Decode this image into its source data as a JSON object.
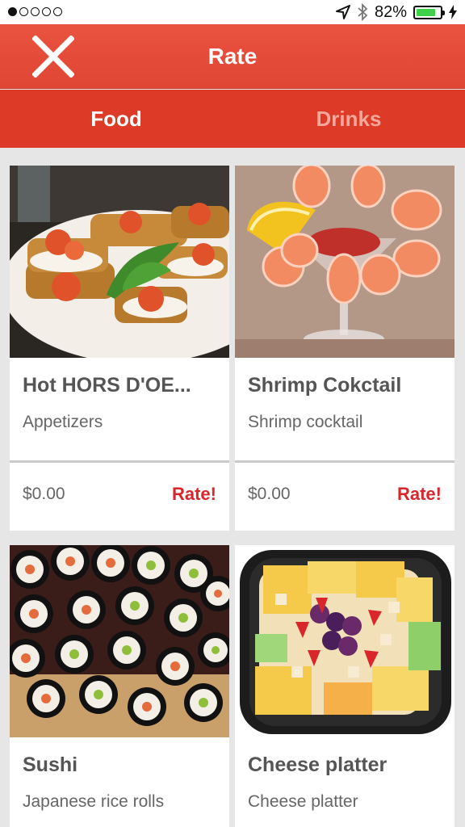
{
  "status_bar": {
    "signal_dots": 5,
    "signal_filled": 1,
    "battery_text": "82%",
    "battery_level": 0.82,
    "icons": [
      "location-arrow-icon",
      "bluetooth-icon",
      "battery-icon",
      "charging-bolt-icon"
    ]
  },
  "navbar": {
    "title": "Rate",
    "close_icon": "close-icon"
  },
  "tabs": [
    {
      "label": "Food",
      "active": true
    },
    {
      "label": "Drinks",
      "active": false
    }
  ],
  "items": [
    {
      "title": "Hot HORS D'OE...",
      "subtitle": "Appetizers",
      "price": "$0.00",
      "action": "Rate!",
      "image": "bruschetta-photo"
    },
    {
      "title": "Shrimp Cokctail",
      "subtitle": "Shrimp cocktail",
      "price": "$0.00",
      "action": "Rate!",
      "image": "shrimp-cocktail-photo"
    },
    {
      "title": "Sushi",
      "subtitle": "Japanese rice rolls",
      "image": "sushi-photo"
    },
    {
      "title": "Cheese platter",
      "subtitle": "Cheese platter",
      "image": "cheese-platter-photo"
    }
  ],
  "colors": {
    "navbar": "#e04634",
    "tabbar": "#dd3a27",
    "rate_accent": "#d9262a",
    "background": "#e6e6e6"
  }
}
